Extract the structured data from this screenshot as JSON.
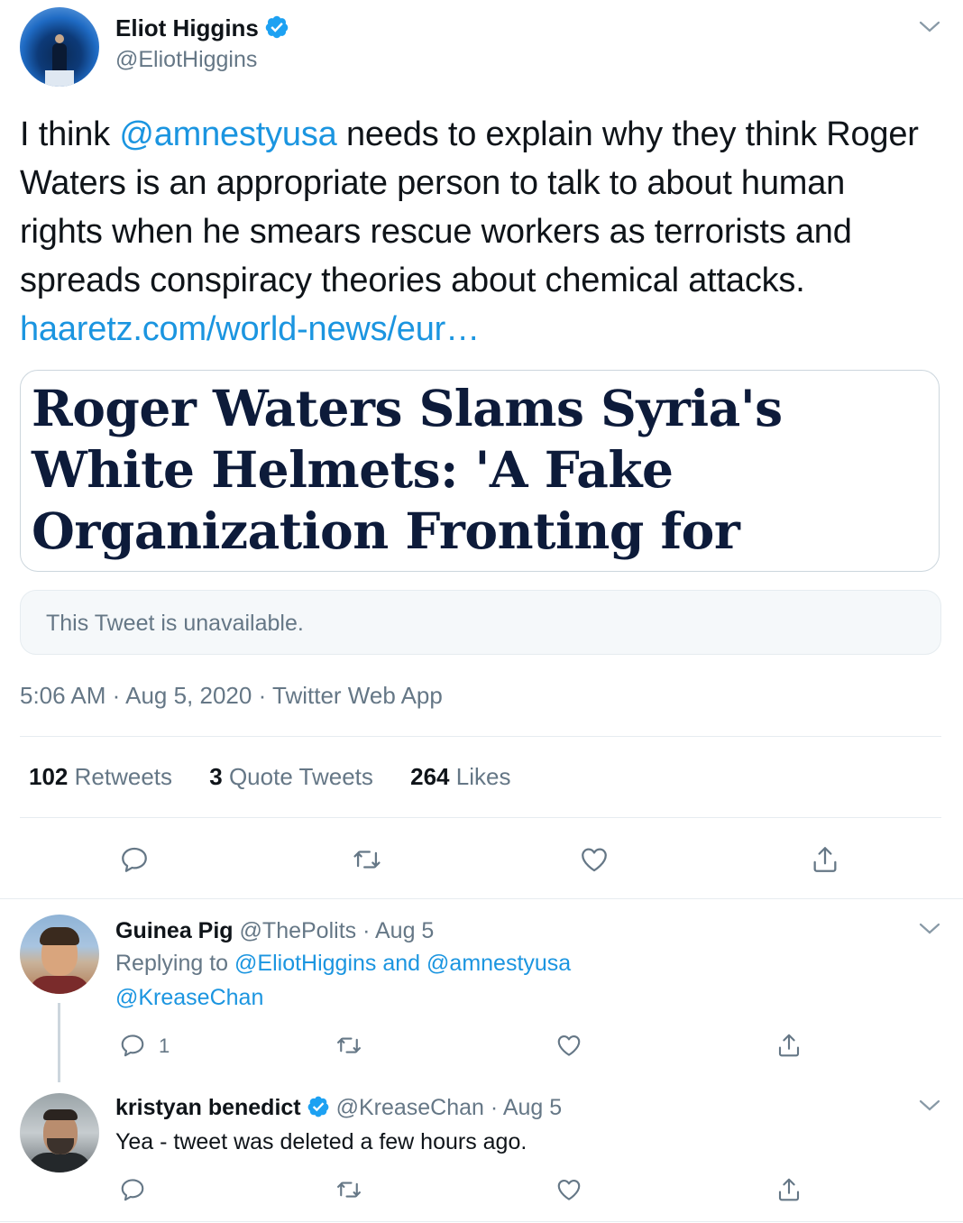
{
  "main_tweet": {
    "author_name": "Eliot Higgins",
    "author_handle": "@EliotHiggins",
    "text_part1": "I think ",
    "mention": "@amnestyusa",
    "text_part2": " needs to explain why they think Roger Waters is an appropriate person to talk to about human rights when he smears rescue workers as terrorists and spreads conspiracy theories about chemical attacks. ",
    "link": "haaretz.com/world-news/eur…",
    "card_headline": "Roger Waters Slams Syria's White Helmets: 'A Fake Organization Fronting for Terrorists'",
    "quoted_unavailable": "This Tweet is unavailable.",
    "time": "5:06 AM",
    "date": "Aug 5, 2020",
    "source": "Twitter Web App",
    "separator": "·",
    "stats": {
      "retweets_count": "102",
      "retweets_label": "Retweets",
      "quotes_count": "3",
      "quotes_label": "Quote Tweets",
      "likes_count": "264",
      "likes_label": "Likes"
    }
  },
  "replies": [
    {
      "name": "Guinea Pig",
      "handle": "@ThePolits",
      "date": "Aug 5",
      "replying_prefix": "Replying to ",
      "replying_to_1": "@EliotHiggins",
      "replying_and": " and ",
      "replying_to_2": "@amnestyusa",
      "text": "@KreaseChan",
      "reply_count": "1"
    },
    {
      "name": "kristyan benedict",
      "handle": "@KreaseChan",
      "date": "Aug 5",
      "text": "Yea - tweet was deleted a few hours ago."
    }
  ],
  "colors": {
    "link_blue": "#1b95e0",
    "verified_blue": "#1da1f2",
    "secondary_text": "#657786",
    "border": "#e6ecf0"
  },
  "icons": [
    "verified-badge-icon",
    "chevron-down-icon",
    "reply-icon",
    "retweet-icon",
    "like-icon",
    "share-icon"
  ]
}
